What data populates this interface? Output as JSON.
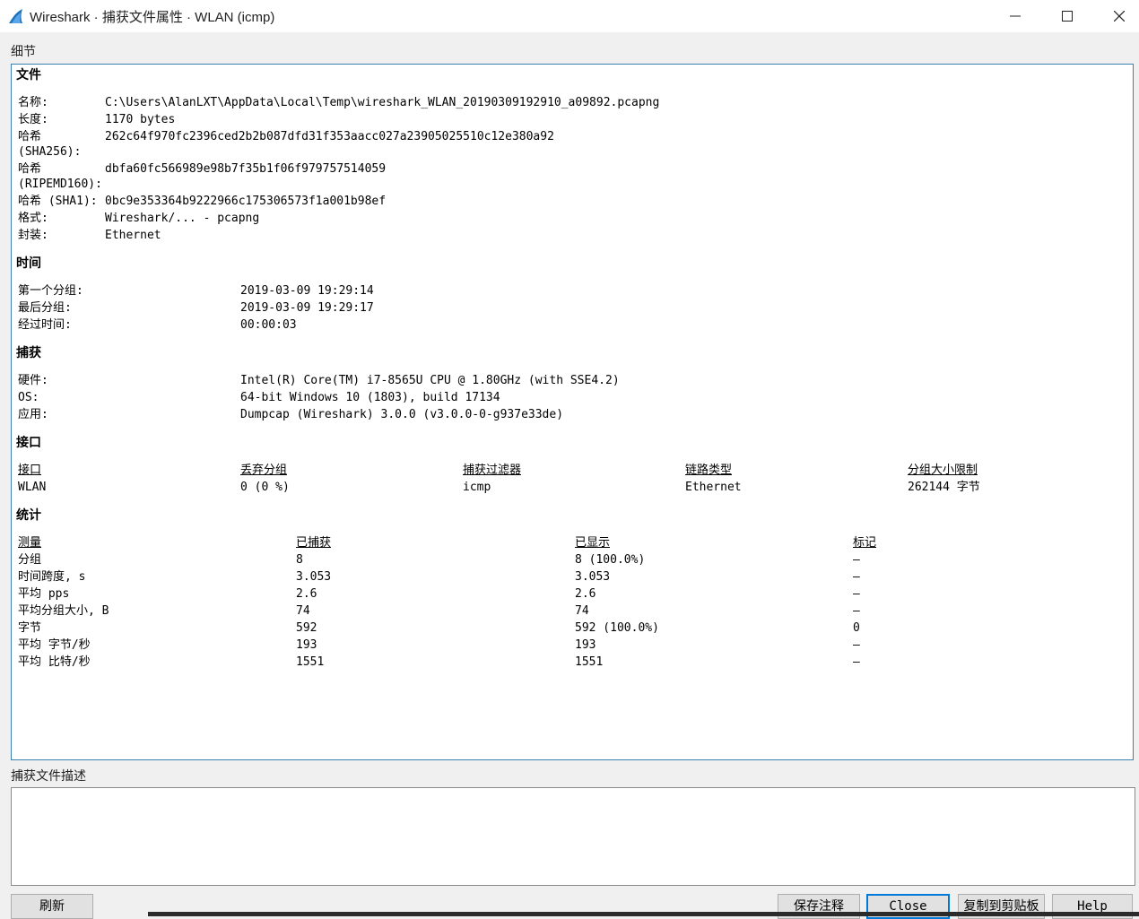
{
  "window": {
    "title": "Wireshark · 捕获文件属性 · WLAN (icmp)"
  },
  "details_label": "细节",
  "file": {
    "heading": "文件",
    "rows": [
      {
        "label": "名称:",
        "value": "C:\\Users\\AlanLXT\\AppData\\Local\\Temp\\wireshark_WLAN_20190309192910_a09892.pcapng"
      },
      {
        "label": "长度:",
        "value": "1170 bytes"
      },
      {
        "label": "哈希",
        "label2": "(SHA256):",
        "value": "262c64f970fc2396ced2b2b087dfd31f353aacc027a23905025510c12e380a92"
      },
      {
        "label": "哈希",
        "label2": "(RIPEMD160):",
        "value": "dbfa60fc566989e98b7f35b1f06f979757514059"
      },
      {
        "label": "哈希 (SHA1):",
        "value": "0bc9e353364b9222966c175306573f1a001b98ef"
      },
      {
        "label": "格式:",
        "value": "Wireshark/... - pcapng"
      },
      {
        "label": "封装:",
        "value": "Ethernet"
      }
    ]
  },
  "time": {
    "heading": "时间",
    "rows": [
      {
        "label": "第一个分组:",
        "value": "2019-03-09 19:29:14"
      },
      {
        "label": "最后分组:",
        "value": "2019-03-09 19:29:17"
      },
      {
        "label": "经过时间:",
        "value": "00:00:03"
      }
    ]
  },
  "capture": {
    "heading": "捕获",
    "rows": [
      {
        "label": "硬件:",
        "value": "Intel(R) Core(TM) i7-8565U CPU @ 1.80GHz (with SSE4.2)"
      },
      {
        "label": "OS:",
        "value": "64-bit Windows 10 (1803), build 17134"
      },
      {
        "label": "应用:",
        "value": "Dumpcap (Wireshark) 3.0.0 (v3.0.0-0-g937e33de)"
      }
    ]
  },
  "interface": {
    "heading": "接口",
    "columns": [
      "接口",
      "丢弃分组",
      "捕获过滤器",
      "链路类型",
      "分组大小限制"
    ],
    "row": [
      "WLAN",
      "0 (0 %)",
      "icmp",
      "Ethernet",
      "262144 字节"
    ]
  },
  "stats": {
    "heading": "统计",
    "columns": [
      "测量",
      "已捕获",
      "已显示",
      "标记"
    ],
    "rows": [
      [
        "分组",
        "8",
        "8 (100.0%)",
        "—"
      ],
      [
        "时间跨度, s",
        "3.053",
        "3.053",
        "—"
      ],
      [
        "平均 pps",
        "2.6",
        "2.6",
        "—"
      ],
      [
        "平均分组大小, B",
        "74",
        "74",
        "—"
      ],
      [
        "字节",
        "592",
        "592 (100.0%)",
        "0"
      ],
      [
        "平均 字节/秒",
        "193",
        "193",
        "—"
      ],
      [
        "平均 比特/秒",
        "1551",
        "1551",
        "—"
      ]
    ]
  },
  "description_label": "捕获文件描述",
  "description_value": "",
  "buttons": {
    "refresh": "刷新",
    "save_comment": "保存注释",
    "close": "Close",
    "copy": "复制到剪贴板",
    "help": "Help"
  }
}
